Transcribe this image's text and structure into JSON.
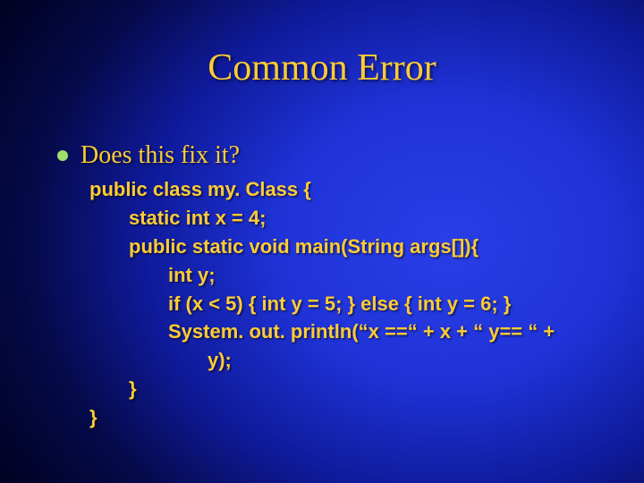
{
  "title": "Common Error",
  "bullet": "Does this fix it?",
  "code": {
    "l1": "public class my. Class {",
    "l2": "static int x = 4;",
    "l3": "public static void main(String args[]){",
    "l4": "int y;",
    "l5": "if (x < 5) { int y = 5; } else { int y = 6; }",
    "l6": "System. out. println(“x ==“ + x + “ y== “ +",
    "l7": "y);",
    "l8": "}",
    "l9": "}"
  }
}
